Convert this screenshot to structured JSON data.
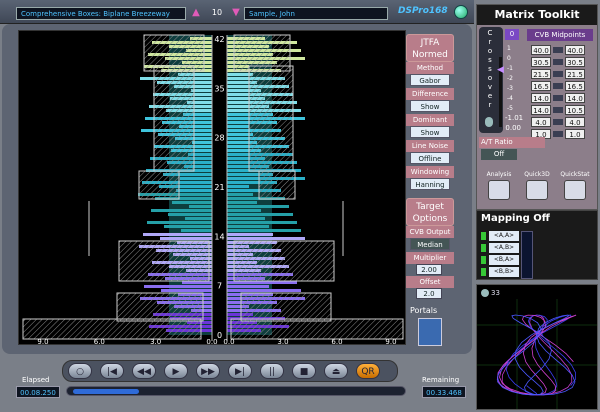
{
  "header": {
    "file_title": "Comprehensive Boxes: Biplane Breezeway",
    "page_number": "10",
    "speaker": "Sample, John",
    "brand": "DSPro168"
  },
  "display": {
    "y_ticks": [
      "42",
      "35",
      "28",
      "21",
      "14",
      "7",
      "0"
    ],
    "x_ticks_left": [
      "9.0",
      "6.0",
      "3.0",
      "0.0"
    ],
    "x_ticks_right": [
      "0.0",
      "3.0",
      "6.0",
      "9.0"
    ]
  },
  "options": {
    "jtfa_title": "JTFA Normed",
    "method_label": "Method",
    "method_value": "Gabor",
    "difference_label": "Difference",
    "difference_value": "Show",
    "dominant_label": "Dominant",
    "dominant_value": "Show",
    "line_noise_label": "Line Noise",
    "line_noise_value": "Offline",
    "windowing_label": "Windowing",
    "windowing_value": "Hanning",
    "target_title": "Target Options",
    "cvb_output_label": "CVB Output",
    "cvb_output_value": "Median",
    "multiplier_label": "Multiplier",
    "multiplier_value": "2.00",
    "offset_label": "Offset",
    "offset_value": "2.0",
    "portals_label": "Portals"
  },
  "transport": {
    "buttons": [
      "○",
      "|◀",
      "◀◀",
      "▶",
      "▶▶",
      "▶|",
      "||",
      "■",
      "⏏",
      "QR"
    ],
    "elapsed_label": "Elapsed",
    "elapsed_value": "00.08.250",
    "remaining_label": "Remaining",
    "remaining_value": "00.33.468",
    "progress_fraction": 0.2
  },
  "matrix_toolkit": {
    "title": "Matrix Toolkit",
    "crossover_label": "Crossover",
    "zero_button": "0",
    "ticks": [
      "1",
      "0",
      "-1",
      "-2",
      "-3",
      "-4",
      "-5"
    ],
    "cvb_header": "CVB Midpoints",
    "cvb_left": [
      "40.0",
      "30.5",
      "21.5",
      "16.5",
      "14.0",
      "14.0",
      "4.0",
      "1.0"
    ],
    "cvb_right": [
      "40.0",
      "30.5",
      "21.5",
      "16.5",
      "14.0",
      "10.5",
      "4.0",
      "1.0"
    ],
    "readout_top": "-1.01",
    "readout_bottom": "0.00",
    "at_ratio_label": "A/T Ratio",
    "at_ratio_value": "Off",
    "tools": [
      "Analysis",
      "Quick3D",
      "QuickStat"
    ],
    "accent": "#7a48c4"
  },
  "mapping": {
    "title": "Mapping Off",
    "rows": [
      "<A,A>",
      "<A,B>",
      "<B,A>",
      "<B,B>"
    ]
  },
  "scope": {
    "value": "33"
  }
}
